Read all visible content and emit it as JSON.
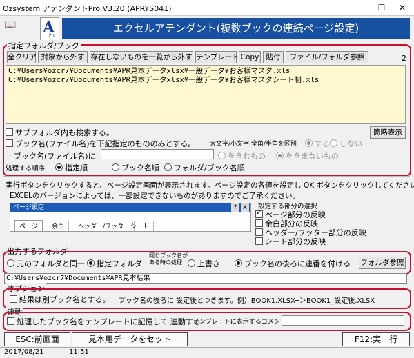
{
  "window": {
    "title": "Ozsystem アテンダントPro V3.20 (APRYS041)",
    "minimize": "—",
    "maximize": "☐",
    "close": "✕"
  },
  "header": {
    "logo_letter": "A",
    "logo_sub": "Pro",
    "banner": "エクセルアテンダント(複数ブックの連続ページ設定)"
  },
  "folder_section": {
    "title": "指定フォルダ/ブック",
    "count": "2",
    "buttons": [
      "全クリア",
      "対象から外す",
      "存在しないものを一覧から外す",
      "テンプレート",
      "Copy",
      "貼付",
      "ファイル/フォルダ参照"
    ],
    "files": [
      "C:¥Users¥ozcr7¥Documents¥APR見本データxlsx¥一般データ¥お客様マスタ.xls",
      "C:¥Users¥ozcr7¥Documents¥APR見本データxlsx¥一般データ¥お客様マスタシート制.xls"
    ],
    "subfolder_label": "サブフォルダ内も検索する。",
    "simple_button": "簡略表示",
    "book_filter_label": "ブック名(ファイル名)を下記指定のもののみとする。",
    "case_label": "大文字/小文字 全角/半角を区別",
    "case_yes": "する",
    "case_no": "しない",
    "book_name_label": "ブック名(ファイル名)に",
    "book_name_value": "",
    "include_label": "を含むもの",
    "exclude_label": "を含まないもの",
    "order_label": "処理する順序",
    "order_options": [
      "指定順",
      "ブック名順",
      "フォルダ/ブック名順"
    ]
  },
  "info": {
    "line1": "実行ボタンをクリックすると、ページ設定画面が表示されます。ページ設定の各値を設定し OK ボタンをクリックしてください。",
    "line2": "EXCELのバージョンによっては、一部設定できないものがありますのでご了承ください。",
    "dialog_title": "ページ設定",
    "dialog_q": "?",
    "dialog_x": "X",
    "dialog_tabs": [
      "ページ",
      "余白",
      "ヘッダー/フッター",
      "シート"
    ],
    "reflect_title": "設定する部分の選択",
    "reflect_items": [
      {
        "label": "ページ部分の反映",
        "checked": true
      },
      {
        "label": "余白部分の反映",
        "checked": false
      },
      {
        "label": "ヘッダー/フッター部分の反映",
        "checked": false
      },
      {
        "label": "シート部分の反映",
        "checked": false
      }
    ]
  },
  "output": {
    "title": "出力するフォルダ",
    "original_folder": "元のフォルダと同一",
    "specified_folder": "指定フォルダ",
    "same_name_line1": "同じブック名が",
    "same_name_line2": "ある時の処理",
    "overwrite": "上書き",
    "append_number": "ブック名の後ろに連番を付ける",
    "browse_button": "フォルダ参照",
    "path": "C:¥Users¥ozcr7¥Documents¥APR見本結果"
  },
  "options": {
    "title": "オプション",
    "separate_book_label": "結果は別ブック名とする。",
    "separate_book_note": "ブック名の後ろに 設定後とつきます。例）BOOK1.XLSX─＞BOOK1_設定後.XLSX"
  },
  "link": {
    "title": "連動",
    "template_label": "処理したブック名をテンプレートに記憶して 連動する",
    "comment_label": "テンプレートに表示するコメント",
    "comment_value": ""
  },
  "footer": {
    "esc_button": "ESC:前画面",
    "sample_button": "見本用データをセット",
    "f12_button": "F12:実　行"
  },
  "status": {
    "date": "2017/08/21",
    "time": "11:51"
  }
}
